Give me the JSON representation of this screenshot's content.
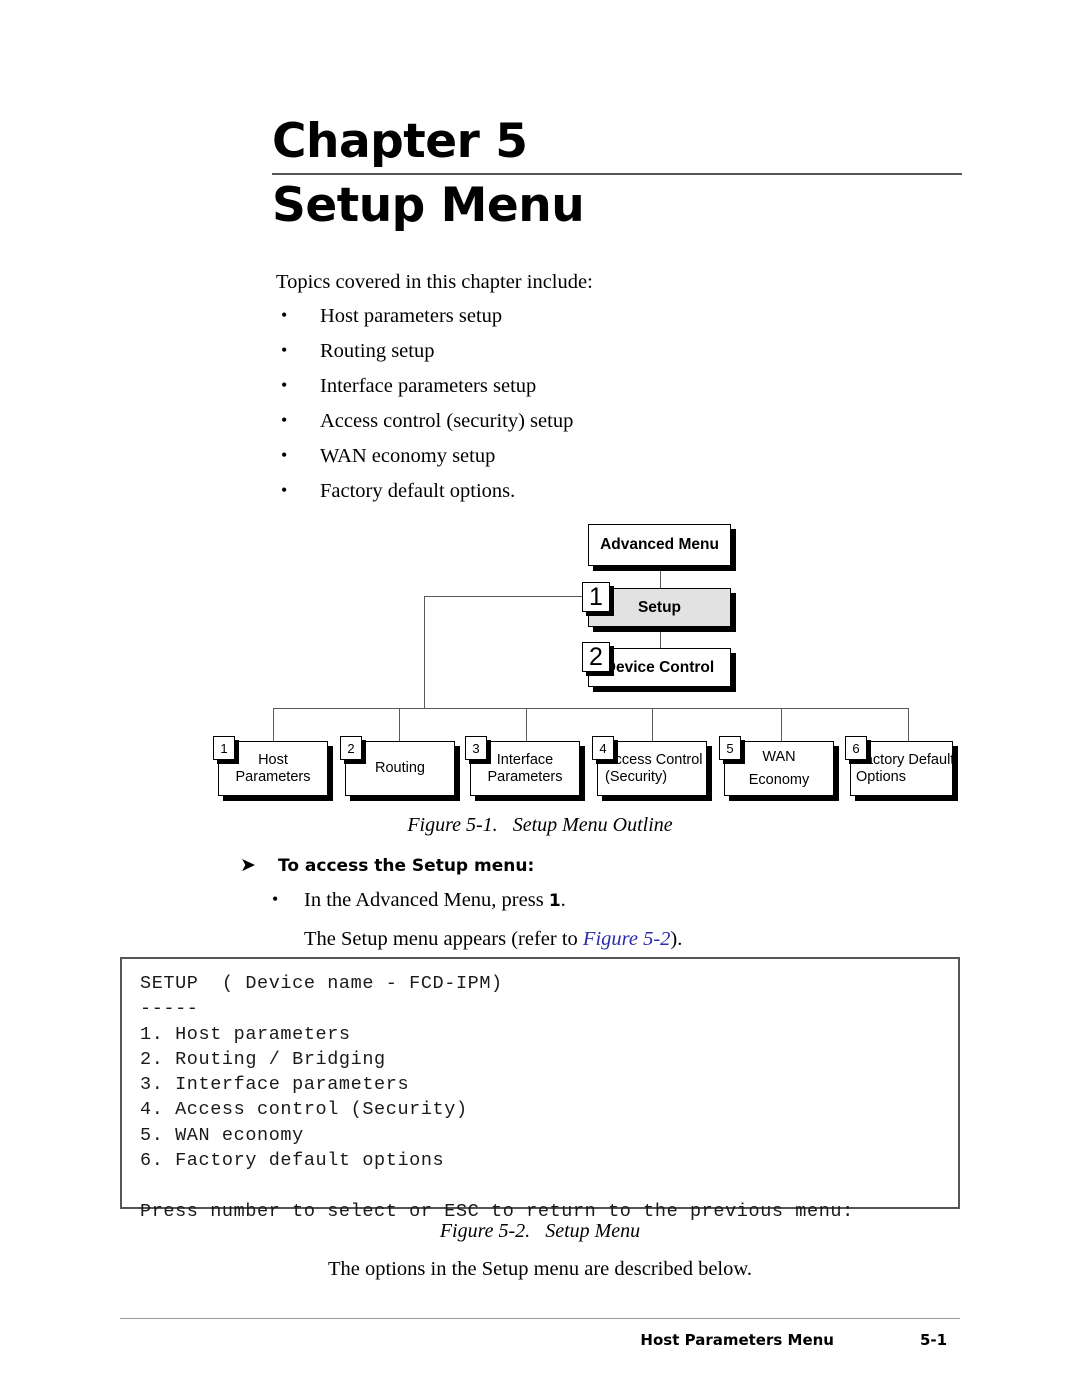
{
  "chapter": {
    "label": "Chapter 5",
    "title": "Setup Menu"
  },
  "intro": {
    "lead": "Topics covered in this chapter include:",
    "bullet_glyph": "•",
    "topics": [
      "Host parameters setup",
      "Routing setup",
      "Interface parameters setup",
      "Access control (security) setup",
      "WAN economy setup",
      "Factory default options."
    ]
  },
  "diagram": {
    "root": {
      "label": "Advanced Menu"
    },
    "branches": [
      {
        "badge": "1",
        "label": "Setup",
        "shaded": true
      },
      {
        "badge": "2",
        "label": "Device Control",
        "shaded": false
      }
    ],
    "leaves": [
      {
        "badge": "1",
        "line1": "Host",
        "line2": "Parameters"
      },
      {
        "badge": "2",
        "line1": "Routing",
        "line2": ""
      },
      {
        "badge": "3",
        "line1": "Interface",
        "line2": "Parameters"
      },
      {
        "badge": "4",
        "line1": "Access Control",
        "line2": "(Security)"
      },
      {
        "badge": "5",
        "line1": "WAN",
        "line2": "Economy"
      },
      {
        "badge": "6",
        "line1": "Factory Default",
        "line2": "Options"
      }
    ]
  },
  "figure1_caption": {
    "number": "Figure 5-1.",
    "title": "Setup Menu Outline"
  },
  "procedure": {
    "arrow_glyph": "➤",
    "heading": "To access the Setup menu:",
    "bullet_glyph": "•",
    "step_prefix": "In the Advanced Menu, press ",
    "step_key": "1",
    "step_suffix": ".",
    "note_prefix": "The Setup menu appears (refer to ",
    "note_link": "Figure 5-2",
    "note_suffix": ")."
  },
  "terminal": {
    "lines": [
      "SETUP  ( Device name - FCD-IPM)",
      "-----",
      "1. Host parameters",
      "2. Routing / Bridging",
      "3. Interface parameters",
      "4. Access control (Security)",
      "5. WAN economy",
      "6. Factory default options",
      "",
      "Press number to select or ESC to return to the previous menu:"
    ]
  },
  "figure2_caption": {
    "number": "Figure 5-2.",
    "title": "Setup Menu"
  },
  "closing": "The options in the Setup menu are described below.",
  "footer": {
    "section": "Host Parameters Menu",
    "page": "5-1"
  },
  "colors": {
    "rule": "#555555",
    "shaded_box": "#e2e2e2",
    "link": "#2a2ab0",
    "connector": "#5a5a5a"
  }
}
